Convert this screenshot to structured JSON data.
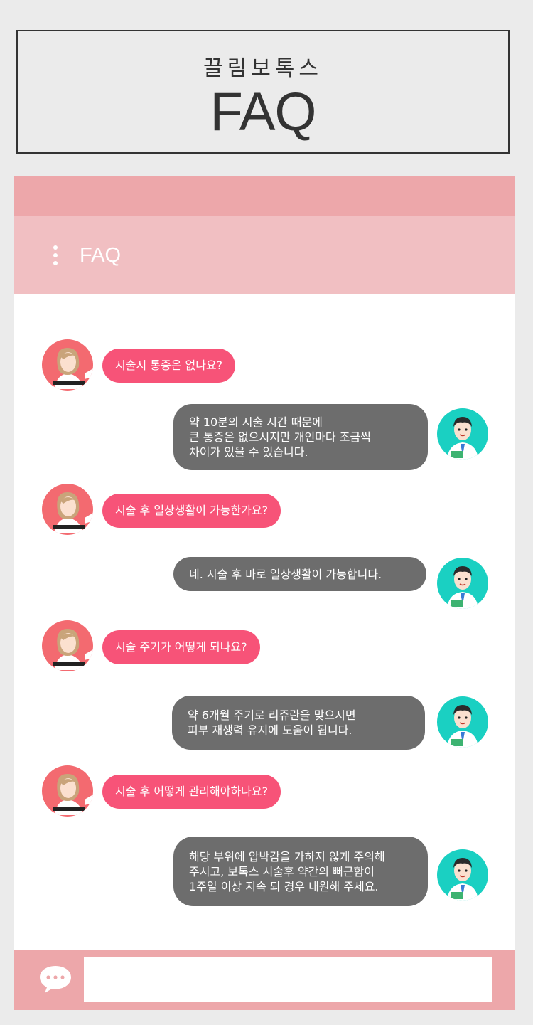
{
  "header": {
    "subtitle": "끌림보톡스",
    "title": "FAQ"
  },
  "app": {
    "title": "FAQ"
  },
  "messages": [
    {
      "role": "question",
      "text": "시술시 통증은 없나요?"
    },
    {
      "role": "answer",
      "text": "약 10분의 시술 시간 때문에\n큰 통증은 없으시지만 개인마다 조금씩\n차이가 있을 수 있습니다."
    },
    {
      "role": "question",
      "text": "시술 후 일상생활이 가능한가요?"
    },
    {
      "role": "answer",
      "text": "네. 시술 후 바로 일상생활이 가능합니다."
    },
    {
      "role": "question",
      "text": "시술 주기가 어떻게 되나요?"
    },
    {
      "role": "answer",
      "text": "약 6개월 주기로 리쥬란을 맞으시면\n피부 재생력 유지에 도움이 됩니다."
    },
    {
      "role": "question",
      "text": "시술 후 어떻게 관리해야하나요?"
    },
    {
      "role": "answer",
      "text": "해당 부위에 압박감을 가하지 않게 주의해\n주시고, 보톡스 시술후 약간의 뻐근함이\n1주일 이상 지속 되 경우 내원해 주세요."
    }
  ],
  "input": {
    "value": "",
    "icon": "chat-bubble-icon"
  },
  "colors": {
    "background": "#ebebeb",
    "status_bar": "#eda7aa",
    "app_bar": "#f1bfc2",
    "question_bubble": "#f75378",
    "answer_bubble": "#6d6d6d",
    "patient_avatar": "#f36a70",
    "doctor_avatar": "#1ad0c2"
  }
}
